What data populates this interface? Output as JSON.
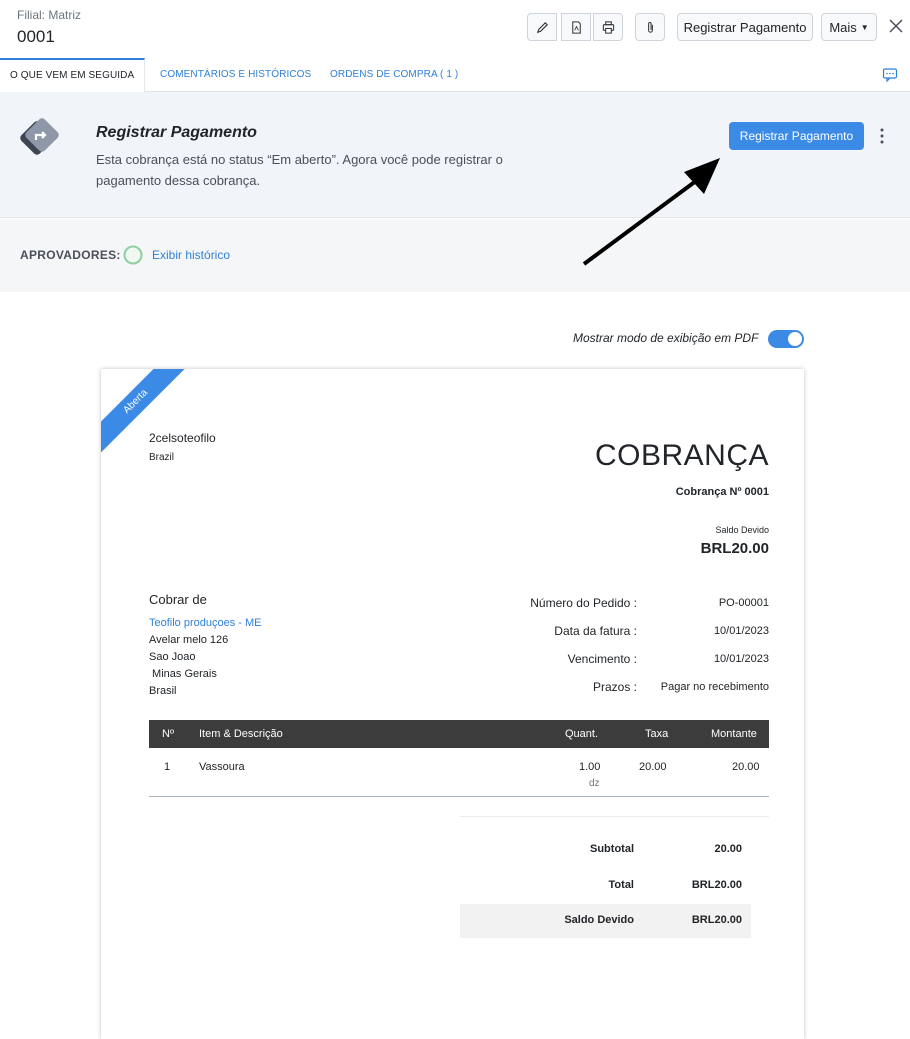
{
  "header": {
    "branch_label": "Filial: Matriz",
    "doc_number": "0001",
    "register_payment_label": "Registrar Pagamento",
    "more_label": "Mais"
  },
  "tabs": [
    {
      "label": "O que vem em seguida",
      "active": true
    },
    {
      "label": "Comentários e históricos",
      "active": false
    },
    {
      "label": "Ordens de compra ( 1 )",
      "active": false
    }
  ],
  "next_step": {
    "title": "Registrar Pagamento",
    "description": "Esta cobrança está no status “Em aberto”. Agora você pode registrar o pagamento dessa cobrança.",
    "button_label": "Registrar Pagamento"
  },
  "approvers": {
    "label": "APROVADORES:",
    "history_link": "Exibir histórico"
  },
  "pdf_toggle": {
    "label": "Mostrar modo de exibição em PDF",
    "enabled": true
  },
  "invoice": {
    "ribbon": "Aberta",
    "org_name": "2celsoteofilo",
    "org_country": "Brazil",
    "title": "COBRANÇA",
    "number_line": "Cobrança Nº 0001",
    "balance_label": "Saldo Devido",
    "balance_value": "BRL20.00",
    "bill_to_title": "Cobrar de",
    "bill_to_name": "Teofilo produçoes - ME",
    "bill_to_address": [
      "Avelar melo 126",
      "Sao Joao",
      " Minas Gerais",
      "Brasil"
    ],
    "meta": [
      {
        "label": "Número do Pedido :",
        "value": "PO-00001"
      },
      {
        "label": "Data da fatura :",
        "value": "10/01/2023"
      },
      {
        "label": "Vencimento :",
        "value": "10/01/2023"
      },
      {
        "label": "Prazos :",
        "value": "Pagar no recebimento"
      }
    ],
    "columns": {
      "num": "Nº",
      "item": "Item & Descrição",
      "qty": "Quant.",
      "rate": "Taxa",
      "amount": "Montante"
    },
    "items": [
      {
        "num": "1",
        "item": "Vassoura",
        "qty": "1.00",
        "unit": "dz",
        "rate": "20.00",
        "amount": "20.00"
      }
    ],
    "totals": {
      "subtotal_label": "Subtotal",
      "subtotal_value": "20.00",
      "total_label": "Total",
      "total_value": "BRL20.00",
      "due_label": "Saldo Devido",
      "due_value": "BRL20.00"
    }
  },
  "colors": {
    "accent": "#3b8be6",
    "link": "#2f80d9",
    "table_header": "#3c3c3c"
  },
  "icons": [
    "pencil-icon",
    "pdf-icon",
    "printer-icon",
    "paperclip-icon",
    "close-icon",
    "chat-icon",
    "kebab-icon",
    "next-step-icon",
    "approver-avatar-icon"
  ]
}
